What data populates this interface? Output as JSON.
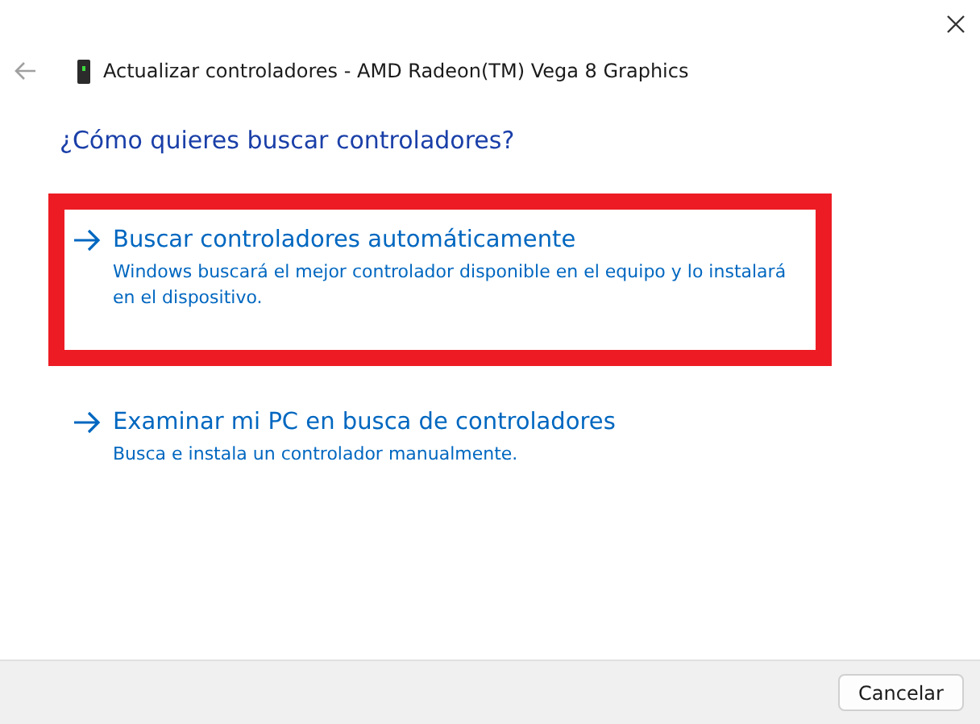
{
  "window": {
    "title": "Actualizar controladores - AMD Radeon(TM) Vega 8 Graphics"
  },
  "heading": "¿Cómo quieres buscar controladores?",
  "options": [
    {
      "title": "Buscar controladores automáticamente",
      "description": "Windows buscará el mejor controlador disponible en el equipo y lo instalará en el dispositivo.",
      "highlighted": true
    },
    {
      "title": "Examinar mi PC en busca de controladores",
      "description": "Busca e instala un controlador manualmente.",
      "highlighted": false
    }
  ],
  "buttons": [
    "Cancelar"
  ]
}
